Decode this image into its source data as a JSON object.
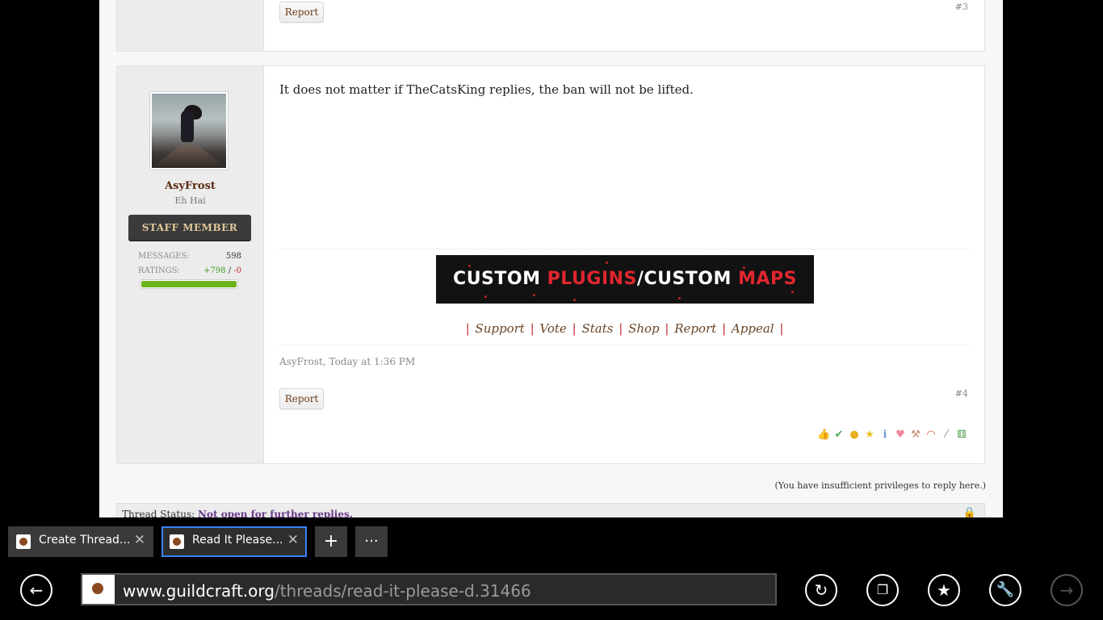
{
  "post3": {
    "report_label": "Report",
    "permalink": "#3"
  },
  "post4": {
    "username": "AsyFrost",
    "user_title": "Eh Hai",
    "staff_badge": "STAFF MEMBER",
    "messages_label": "MESSAGES:",
    "messages_value": "598",
    "ratings_label": "RATINGS:",
    "ratings_pos": "+798",
    "ratings_sep": " / ",
    "ratings_neg": "-0",
    "rating_bar_fraction": 1.0,
    "message": "It does not matter if TheCatsKing replies, the ban will not be lifted.",
    "banner": {
      "part1": "CUSTOM ",
      "part2": "PLUGINS",
      "part3": "/CUSTOM ",
      "part4": "MAPS"
    },
    "sig_links": [
      "Support",
      "Vote",
      "Stats",
      "Shop",
      "Report",
      "Appeal"
    ],
    "meta": "AsyFrost, Today at 1:36 PM",
    "report_label": "Report",
    "permalink": "#4",
    "reactions": [
      "thumbs-up-icon",
      "check-icon",
      "minus-face-icon",
      "star-badge-icon",
      "info-icon",
      "heart-icon",
      "wrench-icon",
      "rainbow-icon",
      "brush-icon",
      "dice-icon"
    ]
  },
  "no_reply_text": "(You have insufficient privileges to reply here.)",
  "thread_status": {
    "label": "Thread Status:",
    "value": "Not open for further replies."
  },
  "browser": {
    "tabs": [
      {
        "title": "Create Thread...",
        "active": false
      },
      {
        "title": "Read It Please...",
        "active": true
      }
    ],
    "new_tab_label": "+",
    "more_label": "···",
    "url_host": "www.guildcraft.org",
    "url_path": "/threads/read-it-please-d.31466",
    "accent": "#3b82f6"
  }
}
